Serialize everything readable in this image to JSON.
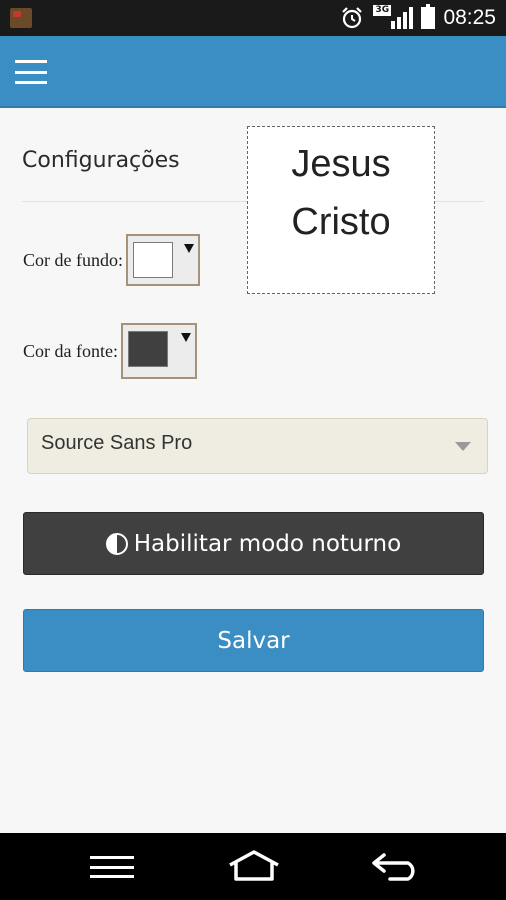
{
  "status_bar": {
    "network_label": "3G",
    "time": "08:25",
    "icons": [
      "app-notification-icon",
      "alarm-clock-icon",
      "signal-3g-icon",
      "battery-icon"
    ]
  },
  "app_bar": {
    "menu_icon": "menu-icon",
    "color": "#3a8ec4"
  },
  "settings": {
    "title": "Configurações",
    "preview": {
      "line1": "Jesus",
      "line2": "Cristo"
    },
    "background_color": {
      "label": "Cor de fundo:",
      "value": "#ffffff"
    },
    "font_color": {
      "label": "Cor da fonte:",
      "value": "#404040"
    },
    "font_select": {
      "selected": "Source Sans Pro"
    },
    "night_mode_button": {
      "label": "Habilitar modo noturno",
      "icon": "contrast-icon"
    },
    "save_button": {
      "label": "Salvar"
    }
  },
  "nav_bar": {
    "icons": [
      "menu-icon",
      "home-icon",
      "back-icon"
    ]
  }
}
